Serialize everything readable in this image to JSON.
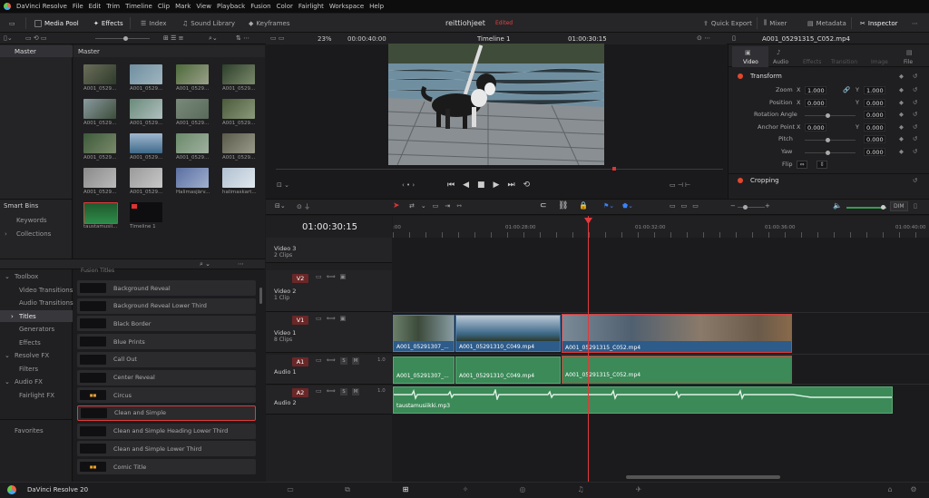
{
  "menubar": {
    "app": "DaVinci Resolve",
    "items": [
      "File",
      "Edit",
      "Trim",
      "Timeline",
      "Clip",
      "Mark",
      "View",
      "Playback",
      "Fusion",
      "Color",
      "Fairlight",
      "Workspace",
      "Help"
    ]
  },
  "toolbar": {
    "media_pool": "Media Pool",
    "effects": "Effects",
    "index": "Index",
    "sound_library": "Sound Library",
    "keyframes": "Keyframes",
    "project": "reittiohjeet",
    "edited": "Edited",
    "quick_export": "Quick Export",
    "mixer": "Mixer",
    "metadata": "Metadata",
    "inspector": "Inspector"
  },
  "viewer": {
    "zoom": "23%",
    "source_tc": "00:00:40:00",
    "timeline_name": "Timeline 1",
    "timecode": "01:00:30:15"
  },
  "bins": {
    "master": "Master",
    "smart_bins": "Smart Bins",
    "keywords": "Keywords",
    "collections": "Collections"
  },
  "media": {
    "header": "Master",
    "clips": [
      {
        "label": "A001_0529..."
      },
      {
        "label": "A001_0529..."
      },
      {
        "label": "A001_0529..."
      },
      {
        "label": "A001_0529..."
      },
      {
        "label": "A001_0529..."
      },
      {
        "label": "A001_0529..."
      },
      {
        "label": "A001_0529..."
      },
      {
        "label": "A001_0529..."
      },
      {
        "label": "A001_0529..."
      },
      {
        "label": "A001_0529..."
      },
      {
        "label": "A001_0529..."
      },
      {
        "label": "A001_0529..."
      },
      {
        "label": "A001_0529..."
      },
      {
        "label": "A001_0529..."
      },
      {
        "label": "Halimasjärv..."
      },
      {
        "label": "halimaskart..."
      },
      {
        "label": "taustamusii..."
      },
      {
        "label": "Timeline 1"
      }
    ]
  },
  "fx": {
    "toolbox": "Toolbox",
    "video_transitions": "Video Transitions",
    "audio_transitions": "Audio Transitions",
    "titles": "Titles",
    "generators": "Generators",
    "effects": "Effects",
    "resolve_fx": "Resolve FX",
    "filters": "Filters",
    "audio_fx": "Audio FX",
    "fairlight_fx": "Fairlight FX",
    "favorites": "Favorites",
    "section": "Fusion Titles",
    "items": [
      {
        "name": "Background Reveal"
      },
      {
        "name": "Background Reveal Lower Third"
      },
      {
        "name": "Black Border"
      },
      {
        "name": "Blue Prints"
      },
      {
        "name": "Call Out"
      },
      {
        "name": "Center Reveal"
      },
      {
        "name": "Circus"
      },
      {
        "name": "Clean and Simple"
      },
      {
        "name": "Clean and Simple Heading Lower Third"
      },
      {
        "name": "Clean and Simple Lower Third"
      },
      {
        "name": "Comic Title"
      }
    ]
  },
  "inspector": {
    "clip_name": "A001_05291315_C052.mp4",
    "tabs": [
      "Video",
      "Audio",
      "Effects",
      "Transition",
      "Image",
      "File"
    ],
    "transform": "Transform",
    "zoom_label": "Zoom",
    "zoom_x": "1.000",
    "zoom_y": "1.000",
    "position_label": "Position",
    "pos_x": "0.000",
    "pos_y": "0.000",
    "rotation_label": "Rotation Angle",
    "rotation": "0.000",
    "anchor_label": "Anchor Point",
    "anchor_x": "0.000",
    "anchor_y": "0.000",
    "pitch_label": "Pitch",
    "pitch": "0.000",
    "yaw_label": "Yaw",
    "yaw": "0.000",
    "flip_label": "Flip",
    "cropping": "Cropping",
    "x": "X",
    "y": "Y"
  },
  "timeline": {
    "timecode": "01:00:30:15",
    "ruler": [
      "01:00:28:00",
      "01:00:32:00",
      "01:00:36:00",
      "01:00:40:00"
    ],
    "ruler_start": ":00",
    "dim": "DIM",
    "tracks": {
      "v3_name": "Video 3",
      "v3_clips": "2 Clips",
      "v2_tag": "V2",
      "v2_name": "Video 2",
      "v2_clips": "1 Clip",
      "v1_tag": "V1",
      "v1_name": "Video 1",
      "v1_clips": "8 Clips",
      "a1_tag": "A1",
      "a1_name": "Audio 1",
      "a1_level": "1.0",
      "a2_tag": "A2",
      "a2_name": "Audio 2",
      "a2_level": "1.0",
      "s": "S",
      "m": "M"
    },
    "clips": {
      "v1a": "A001_05291307_...",
      "v1b": "A001_05291310_C049.mp4",
      "v1c": "A001_05291315_C052.mp4",
      "a1a": "A001_05291307_...",
      "a1b": "A001_05291310_C049.mp4",
      "a1c": "A001_05291315_C052.mp4",
      "a2": "taustamusiikki.mp3"
    }
  },
  "footer": {
    "app_version": "DaVinci Resolve 20"
  }
}
